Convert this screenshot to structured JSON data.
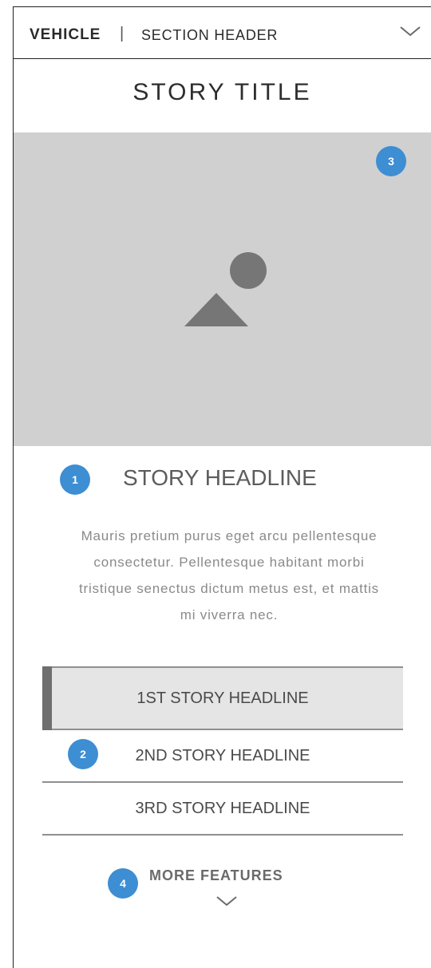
{
  "header": {
    "vehicle_label": "VEHICLE",
    "separator": "|",
    "section_label": "SECTION HEADER",
    "toggle_icon": "chevron-down-icon"
  },
  "story": {
    "title": "STORY TITLE",
    "hero_image_icon": "image-placeholder-icon",
    "headline": "STORY HEADLINE",
    "body": "Mauris pretium purus eget arcu pellentesque consectetur. Pellentesque habitant morbi tristique senectus dictum metus est, et mattis mi viverra nec."
  },
  "story_list": [
    {
      "label": "1ST STORY HEADLINE",
      "active": true
    },
    {
      "label": "2ND STORY HEADLINE",
      "active": false
    },
    {
      "label": "3RD STORY HEADLINE",
      "active": false
    }
  ],
  "more": {
    "label": "MORE FEATURES",
    "icon": "chevron-down-icon"
  },
  "annotations": {
    "badge_1": "1",
    "badge_2": "2",
    "badge_3": "3",
    "badge_4": "4"
  },
  "colors": {
    "annotation_badge": "#3d8ed3",
    "hero_placeholder": "#d0d0d0",
    "active_item_bg": "#e5e5e5",
    "active_item_bar": "#6f6f6f"
  }
}
